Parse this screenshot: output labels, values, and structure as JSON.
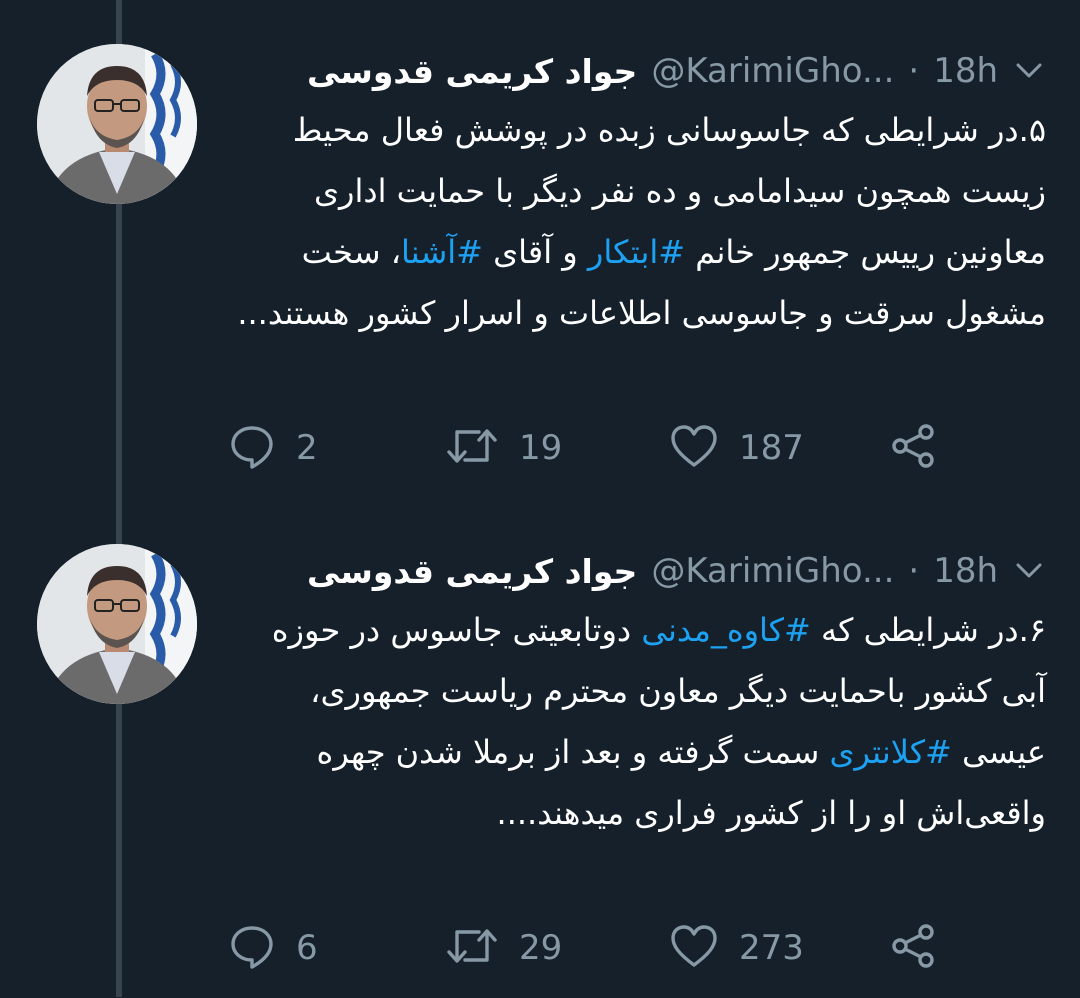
{
  "colors": {
    "background": "#15202b",
    "thread_line": "#38444d",
    "secondary_text": "#8899a6",
    "hashtag": "#1da1f2"
  },
  "tweets": [
    {
      "author_name": "جواد کریمی قدوسی",
      "handle": "@KarimiGho...",
      "separator": "·",
      "time": "18h",
      "menu_icon": "chevron-down-icon",
      "text": [
        {
          "t": "۵.در شرایطی که جاسوسانی زبده در پوشش فعال محیط زیست همچون سیدامامی و ده نفر دیگر با حمایت اداری معاونین رییس جمهور خانم "
        },
        {
          "t": "#ابتکار",
          "tag": true
        },
        {
          "t": " و آقای "
        },
        {
          "t": "#آشنا",
          "tag": true
        },
        {
          "t": "، سخت مشغول سرقت و جاسوسی اطلاعات و اسرار کشور هستند..."
        }
      ],
      "replies": "2",
      "retweets": "19",
      "likes": "187"
    },
    {
      "author_name": "جواد کریمی قدوسی",
      "handle": "@KarimiGho...",
      "separator": "·",
      "time": "18h",
      "menu_icon": "chevron-down-icon",
      "text": [
        {
          "t": "۶.در شرایطی که "
        },
        {
          "t": "#کاوه_مدنی",
          "tag": true
        },
        {
          "t": " دوتابعیتی جاسوس در حوزه آبی کشور باحمایت دیگر معاون محترم ریاست جمهوری، عیسی "
        },
        {
          "t": "#کلانتری",
          "tag": true
        },
        {
          "t": " سمت گرفته و بعد از برملا شدن چهره واقعی‌اش او را از کشور فراری میدهند...."
        }
      ],
      "replies": "6",
      "retweets": "29",
      "likes": "273"
    }
  ]
}
